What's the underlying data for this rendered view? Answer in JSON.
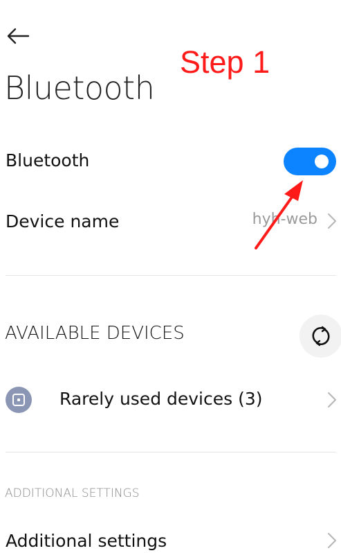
{
  "header": {
    "back_icon": "arrow-left-icon",
    "title": "Bluetooth"
  },
  "annotation": {
    "step_label": "Step 1",
    "color": "#ff1a1a"
  },
  "settings": {
    "bluetooth": {
      "label": "Bluetooth",
      "enabled": true,
      "toggle_color": "#0d84ff"
    },
    "device_name": {
      "label": "Device name",
      "value": "hyh-web"
    }
  },
  "available_devices": {
    "heading": "AVAILABLE DEVICES",
    "refresh_icon": "refresh-icon",
    "rarely_used": {
      "label": "Rarely used devices (3)",
      "icon": "device-icon"
    }
  },
  "additional": {
    "heading": "ADDITIONAL SETTINGS",
    "item_label": "Additional settings"
  }
}
